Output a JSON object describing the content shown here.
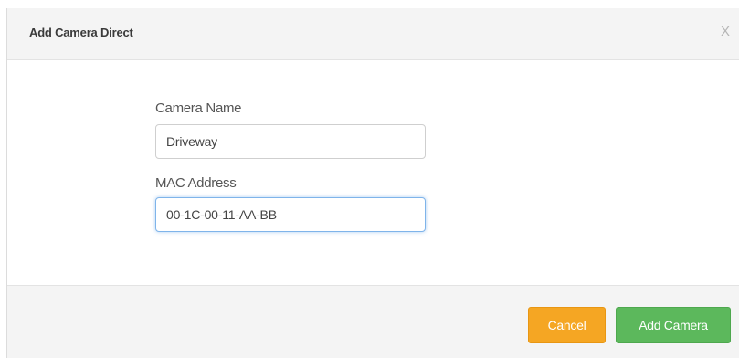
{
  "dialog": {
    "title": "Add Camera Direct",
    "close_label": "X"
  },
  "form": {
    "camera_name": {
      "label": "Camera Name",
      "value": "Driveway"
    },
    "mac_address": {
      "label": "MAC Address",
      "value": "00-1C-00-11-AA-BB"
    }
  },
  "footer": {
    "cancel_label": "Cancel",
    "add_label": "Add Camera"
  },
  "colors": {
    "cancel_button": "#f5a623",
    "add_button": "#5cb85c",
    "focus_border": "#7fb4ea"
  }
}
